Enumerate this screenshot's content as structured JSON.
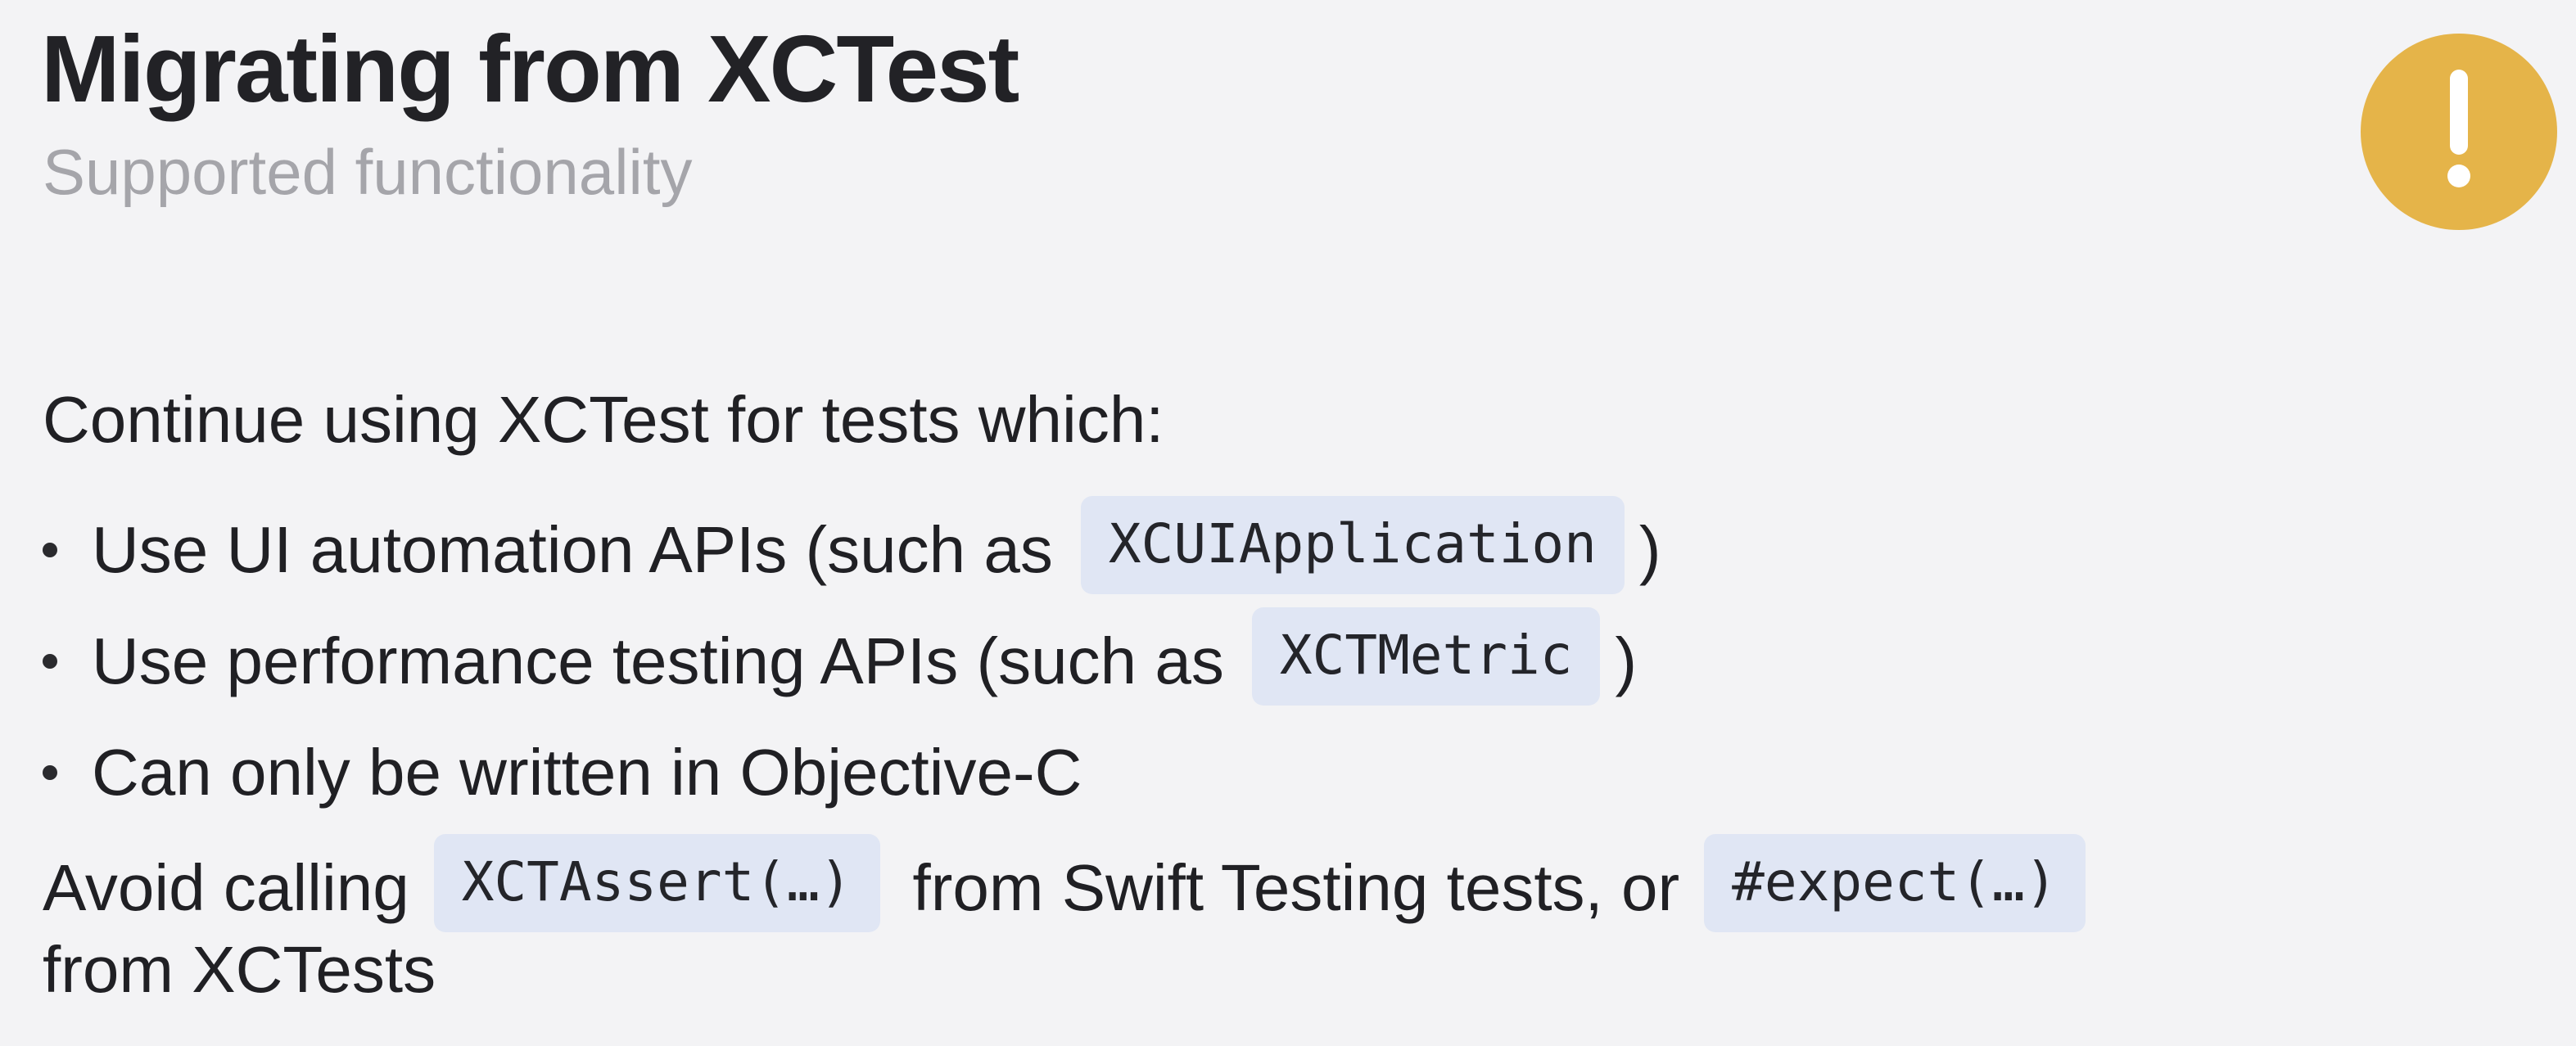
{
  "slide": {
    "title": "Migrating from XCTest",
    "subtitle": "Supported functionality",
    "icon": "exclamation-icon",
    "accent_color": "#e5b449"
  },
  "content": {
    "intro": "Continue using XCTest for tests which:",
    "bullets": [
      {
        "text": "Use UI automation APIs (such as",
        "code": "XCUIApplication",
        "suffix": ")"
      },
      {
        "text": "Use performance testing APIs (such as",
        "code": "XCTMetric",
        "suffix": ")"
      },
      {
        "text": "Can only be written in Objective-C"
      }
    ],
    "avoid": {
      "prefix": "Avoid calling",
      "code1": "XCTAssert(…)",
      "middle": "from Swift Testing tests, or",
      "code2": "#expect(…)",
      "suffix": "from XCTests"
    }
  }
}
